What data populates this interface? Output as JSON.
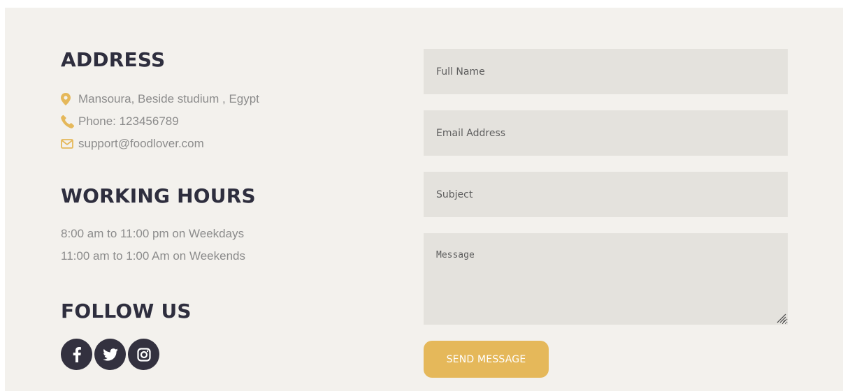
{
  "address": {
    "heading": "ADDRESS",
    "location": "Mansoura, Beside studium , Egypt",
    "phone": "Phone: 123456789",
    "email": "support@foodlover.com"
  },
  "hours": {
    "heading": "WORKING HOURS",
    "weekdays": "8:00 am to 11:00 pm on Weekdays",
    "weekends": "11:00 am to 1:00 Am on Weekends"
  },
  "follow": {
    "heading": "FOLLOW US",
    "icons": [
      "facebook-icon",
      "twitter-icon",
      "instagram-icon"
    ]
  },
  "form": {
    "name_placeholder": "Full Name",
    "email_placeholder": "Email Address",
    "subject_placeholder": "Subject",
    "message_placeholder": "Message",
    "submit_label": "SEND MESSAGE"
  },
  "colors": {
    "accent": "#e5b85a",
    "heading": "#2e2e3e",
    "panel_bg": "#f3f1ed",
    "field_bg": "#e4e2dd",
    "social_bg": "#33313f"
  }
}
